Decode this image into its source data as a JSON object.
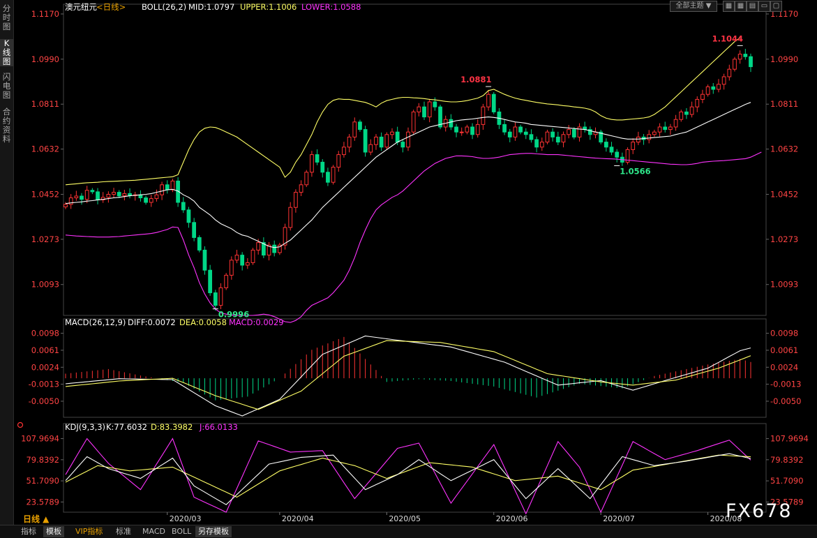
{
  "sidebar_tabs": [
    {
      "label": "分时图",
      "active": false
    },
    {
      "label": "K线图",
      "active": true
    },
    {
      "label": "闪电图",
      "active": false
    },
    {
      "label": "合约资料",
      "active": false
    }
  ],
  "top_controls": {
    "dropdown": "全部主题",
    "icons": [
      "grid-icon",
      "grid-alt-icon",
      "layout-icon",
      "restore-icon",
      "maximize-icon"
    ]
  },
  "bottom_tabs": [
    {
      "label": "指标",
      "active": false,
      "color": "#bbbbbb"
    },
    {
      "label": "模板",
      "active": true,
      "color": "#eeeeee"
    },
    {
      "label": "VIP指标",
      "active": false,
      "color": "#e8a000"
    },
    {
      "label": "标准",
      "active": false,
      "color": "#bbbbbb"
    },
    {
      "label": "MACD",
      "active": false,
      "color": "#bbbbbb"
    },
    {
      "label": "BOLL",
      "active": false,
      "color": "#bbbbbb"
    },
    {
      "label": "另存模板",
      "active": true,
      "color": "#eeeeee"
    }
  ],
  "watermark": "FX678",
  "period_label": "日线 ▲",
  "chart_data": [
    {
      "type": "candlestick",
      "panel": "price",
      "header": {
        "symbol": "澳元纽元",
        "period": "<日线>",
        "indicator": "BOLL(26,2)",
        "mid": "MID:1.0797",
        "upper": "UPPER:1.1006",
        "lower": "LOWER:1.0588"
      },
      "colors": {
        "up": "#ff3333",
        "down": "#00d787",
        "mid": "#ffffff",
        "upper": "#ffff66",
        "lower": "#ff33ff"
      },
      "yticks": [
        "1.1170",
        "1.0990",
        "1.0811",
        "1.0632",
        "1.0452",
        "1.0273",
        "1.0093"
      ],
      "ylim": [
        0.997,
        1.117
      ],
      "xticks": [
        "2020/03",
        "2020/04",
        "2020/05",
        "2020/06",
        "2020/07",
        "2020/08"
      ],
      "xtick_index": [
        19,
        40,
        60,
        80,
        100,
        120
      ],
      "annotations": [
        {
          "label": "1.1044",
          "index": 126,
          "value": 1.1044,
          "color": "#ff3344"
        },
        {
          "label": "1.0881",
          "index": 79,
          "value": 1.0881,
          "color": "#ff3344"
        },
        {
          "label": "0.9996",
          "index": 28,
          "value": 0.9996,
          "color": "#2ee88a"
        },
        {
          "label": "1.0566",
          "index": 103,
          "value": 1.0566,
          "color": "#2ee88a"
        }
      ],
      "close": [
        1.0412,
        1.0438,
        1.0445,
        1.0432,
        1.0468,
        1.0462,
        1.043,
        1.044,
        1.0452,
        1.046,
        1.0446,
        1.0455,
        1.0448,
        1.045,
        1.0438,
        1.042,
        1.0435,
        1.045,
        1.049,
        1.047,
        1.0505,
        1.042,
        1.039,
        1.034,
        1.028,
        1.023,
        1.015,
        1.006,
        1.001,
        1.008,
        1.013,
        1.019,
        1.021,
        1.017,
        1.018,
        1.023,
        1.026,
        1.021,
        1.025,
        1.022,
        1.025,
        1.032,
        1.04,
        1.046,
        1.049,
        1.054,
        1.061,
        1.058,
        1.054,
        1.05,
        1.056,
        1.061,
        1.064,
        1.068,
        1.074,
        1.071,
        1.062,
        1.065,
        1.068,
        1.064,
        1.069,
        1.07,
        1.066,
        1.064,
        1.07,
        1.078,
        1.08,
        1.076,
        1.082,
        1.08,
        1.072,
        1.075,
        1.072,
        1.07,
        1.07,
        1.072,
        1.069,
        1.073,
        1.08,
        1.085,
        1.078,
        1.073,
        1.07,
        1.068,
        1.072,
        1.07,
        1.069,
        1.067,
        1.064,
        1.066,
        1.07,
        1.068,
        1.066,
        1.069,
        1.071,
        1.068,
        1.072,
        1.071,
        1.069,
        1.07,
        1.066,
        1.064,
        1.062,
        1.06,
        1.058,
        1.063,
        1.066,
        1.068,
        1.067,
        1.069,
        1.07,
        1.072,
        1.071,
        1.072,
        1.075,
        1.078,
        1.077,
        1.08,
        1.083,
        1.085,
        1.088,
        1.087,
        1.089,
        1.092,
        1.095,
        1.099,
        1.101,
        1.1,
        1.096
      ],
      "boll_mid": [
        1.0415,
        1.0418,
        1.042,
        1.0422,
        1.0425,
        1.0427,
        1.043,
        1.0432,
        1.0435,
        1.0438,
        1.044,
        1.0443,
        1.0446,
        1.0448,
        1.045,
        1.0452,
        1.0455,
        1.046,
        1.0465,
        1.047,
        1.0472,
        1.0465,
        1.045,
        1.044,
        1.0425,
        1.04,
        1.0385,
        1.037,
        1.035,
        1.0335,
        1.0325,
        1.0315,
        1.03,
        1.029,
        1.0285,
        1.0275,
        1.0265,
        1.0255,
        1.0245,
        1.024,
        1.0243,
        1.0257,
        1.027,
        1.029,
        1.031,
        1.033,
        1.035,
        1.0375,
        1.04,
        1.042,
        1.044,
        1.046,
        1.048,
        1.05,
        1.052,
        1.054,
        1.056,
        1.058,
        1.06,
        1.0615,
        1.063,
        1.0645,
        1.066,
        1.067,
        1.068,
        1.069,
        1.07,
        1.071,
        1.072,
        1.0725,
        1.073,
        1.0735,
        1.074,
        1.0745,
        1.0748,
        1.075,
        1.0752,
        1.0755,
        1.0758,
        1.076,
        1.0758,
        1.0755,
        1.075,
        1.0745,
        1.074,
        1.0738,
        1.0735,
        1.073,
        1.0728,
        1.0726,
        1.0724,
        1.0722,
        1.072,
        1.0718,
        1.0716,
        1.0714,
        1.0712,
        1.071,
        1.0705,
        1.07,
        1.0695,
        1.069,
        1.0685,
        1.068,
        1.0675,
        1.0672,
        1.0672,
        1.0672,
        1.0674,
        1.0676,
        1.0678,
        1.068,
        1.0682,
        1.0684,
        1.069,
        1.0695,
        1.07,
        1.071,
        1.072,
        1.073,
        1.074,
        1.075,
        1.076,
        1.077,
        1.078,
        1.079,
        1.08,
        1.081,
        1.0818
      ],
      "boll_upper": [
        1.049,
        1.0492,
        1.0494,
        1.0496,
        1.0498,
        1.0499,
        1.05,
        1.0502,
        1.0503,
        1.0504,
        1.0505,
        1.0506,
        1.0507,
        1.0508,
        1.051,
        1.0512,
        1.0514,
        1.0516,
        1.0518,
        1.052,
        1.0522,
        1.053,
        1.058,
        1.063,
        1.067,
        1.07,
        1.0715,
        1.072,
        1.0718,
        1.071,
        1.07,
        1.069,
        1.068,
        1.0665,
        1.065,
        1.0635,
        1.062,
        1.0605,
        1.059,
        1.0575,
        1.056,
        1.052,
        1.054,
        1.058,
        1.061,
        1.065,
        1.069,
        1.074,
        1.078,
        1.081,
        1.0826,
        1.0832,
        1.083,
        1.083,
        1.0826,
        1.0822,
        1.0818,
        1.081,
        1.08,
        1.0815,
        1.0825,
        1.083,
        1.0835,
        1.0838,
        1.0838,
        1.0836,
        1.0835,
        1.0833,
        1.083,
        1.0828,
        1.0825,
        1.0822,
        1.082,
        1.082,
        1.0822,
        1.0825,
        1.083,
        1.0835,
        1.0845,
        1.0865,
        1.087,
        1.086,
        1.085,
        1.0842,
        1.0835,
        1.083,
        1.0826,
        1.0822,
        1.0818,
        1.0815,
        1.0812,
        1.081,
        1.0808,
        1.0805,
        1.0803,
        1.08,
        1.0798,
        1.0795,
        1.079,
        1.078,
        1.0765,
        1.0755,
        1.075,
        1.0748,
        1.0748,
        1.075,
        1.0752,
        1.0754,
        1.0756,
        1.076,
        1.077,
        1.0785,
        1.08,
        1.082,
        1.084,
        1.086,
        1.088,
        1.09,
        1.092,
        1.094,
        1.096,
        1.098,
        1.1,
        1.102,
        1.104,
        1.106,
        1.1075
      ],
      "boll_lower": [
        1.029,
        1.0288,
        1.0286,
        1.0285,
        1.0284,
        1.0283,
        1.0282,
        1.0282,
        1.0282,
        1.0283,
        1.0284,
        1.0286,
        1.0288,
        1.029,
        1.0292,
        1.0294,
        1.0296,
        1.03,
        1.0306,
        1.0312,
        1.0322,
        1.032,
        1.027,
        1.021,
        1.016,
        1.01,
        1.0055,
        1.002,
        0.9995,
        0.998,
        0.9975,
        0.9972,
        0.997,
        0.997,
        0.997,
        0.997,
        0.9972,
        0.9975,
        0.9972,
        0.9965,
        0.9955,
        0.9945,
        0.9942,
        0.995,
        0.9965,
        0.999,
        1.001,
        1.002,
        1.003,
        1.004,
        1.006,
        1.0085,
        1.011,
        1.015,
        1.02,
        1.026,
        1.031,
        1.0355,
        1.039,
        1.041,
        1.0425,
        1.044,
        1.045,
        1.0465,
        1.0485,
        1.0505,
        1.0525,
        1.0545,
        1.056,
        1.0575,
        1.0585,
        1.0595,
        1.06,
        1.0605,
        1.0605,
        1.0604,
        1.0602,
        1.0598,
        1.0595,
        1.0595,
        1.0597,
        1.06,
        1.0605,
        1.061,
        1.0612,
        1.0614,
        1.0615,
        1.0615,
        1.0613,
        1.0612,
        1.061,
        1.061,
        1.061,
        1.0608,
        1.0606,
        1.0604,
        1.0602,
        1.06,
        1.0598,
        1.0596,
        1.0595,
        1.0594,
        1.0593,
        1.0592,
        1.059,
        1.0588,
        1.0586,
        1.0584,
        1.0582,
        1.058,
        1.0578,
        1.0576,
        1.0574,
        1.0572,
        1.0571,
        1.057,
        1.057,
        1.0572,
        1.0575,
        1.058,
        1.0582,
        1.0584,
        1.0585,
        1.0586,
        1.0588,
        1.059,
        1.0592,
        1.0594,
        1.06,
        1.061,
        1.062
      ]
    },
    {
      "type": "macd",
      "panel": "macd",
      "header": {
        "name": "MACD(26,12,9)",
        "diff": "DIFF:0.0072",
        "dea": "DEA:0.0058",
        "macd": "MACD:0.0029"
      },
      "colors": {
        "diff": "#ffffff",
        "dea": "#ffff66",
        "up": "#ff3333",
        "down": "#00d787"
      },
      "yticks": [
        "0.0098",
        "0.0061",
        "0.0024",
        "-0.0013",
        "-0.0050"
      ],
      "ylim": [
        -0.0085,
        0.0108
      ],
      "diff_keys": [
        [
          0,
          -0.0012
        ],
        [
          10,
          -0.0001
        ],
        [
          20,
          -0.0003
        ],
        [
          28,
          -0.006
        ],
        [
          33,
          -0.0082
        ],
        [
          40,
          -0.0046
        ],
        [
          48,
          0.0052
        ],
        [
          56,
          0.0092
        ],
        [
          64,
          0.008
        ],
        [
          72,
          0.0068
        ],
        [
          82,
          0.0035
        ],
        [
          92,
          -0.0015
        ],
        [
          100,
          -0.0005
        ],
        [
          106,
          -0.0026
        ],
        [
          112,
          -0.0005
        ],
        [
          120,
          0.0022
        ],
        [
          126,
          0.006
        ],
        [
          130,
          0.0072
        ]
      ],
      "dea_keys": [
        [
          0,
          -0.0018
        ],
        [
          10,
          -0.0006
        ],
        [
          20,
          0.0
        ],
        [
          28,
          -0.0038
        ],
        [
          36,
          -0.0068
        ],
        [
          44,
          -0.0028
        ],
        [
          52,
          0.0048
        ],
        [
          60,
          0.0082
        ],
        [
          70,
          0.0078
        ],
        [
          80,
          0.0058
        ],
        [
          90,
          0.001
        ],
        [
          100,
          -0.0008
        ],
        [
          106,
          -0.0015
        ],
        [
          114,
          -0.0004
        ],
        [
          122,
          0.0022
        ],
        [
          130,
          0.0058
        ]
      ],
      "hist_keys": [
        [
          0,
          0.001
        ],
        [
          8,
          0.002
        ],
        [
          14,
          0.0006
        ],
        [
          22,
          -0.001
        ],
        [
          28,
          -0.0048
        ],
        [
          34,
          -0.004
        ],
        [
          40,
          0.0
        ],
        [
          46,
          0.0062
        ],
        [
          52,
          0.009
        ],
        [
          58,
          0.0018
        ],
        [
          60,
          -0.0008
        ],
        [
          66,
          -0.0002
        ],
        [
          72,
          -0.0006
        ],
        [
          80,
          -0.0018
        ],
        [
          88,
          -0.0042
        ],
        [
          96,
          -0.0012
        ],
        [
          104,
          -0.0022
        ],
        [
          110,
          0.0005
        ],
        [
          120,
          0.003
        ],
        [
          126,
          0.0042
        ],
        [
          130,
          0.0029
        ]
      ]
    },
    {
      "type": "kdj",
      "panel": "kdj",
      "header": {
        "name": "KDJ(9,3,3)",
        "k": "K:77.6032",
        "d": "D:83.3982",
        "j": "J:66.0133"
      },
      "colors": {
        "k": "#ffffff",
        "d": "#ffff66",
        "j": "#ff33ff"
      },
      "yticks": [
        "107.9694",
        "79.8392",
        "51.7090",
        "23.5789"
      ],
      "ylim": [
        10,
        115
      ],
      "k_keys": [
        [
          0,
          52
        ],
        [
          4,
          84
        ],
        [
          8,
          68
        ],
        [
          14,
          55
        ],
        [
          20,
          82
        ],
        [
          24,
          45
        ],
        [
          30,
          20
        ],
        [
          38,
          74
        ],
        [
          44,
          83
        ],
        [
          50,
          86
        ],
        [
          56,
          40
        ],
        [
          62,
          60
        ],
        [
          66,
          80
        ],
        [
          72,
          52
        ],
        [
          80,
          80
        ],
        [
          86,
          28
        ],
        [
          92,
          68
        ],
        [
          98,
          28
        ],
        [
          104,
          84
        ],
        [
          110,
          72
        ],
        [
          116,
          78
        ],
        [
          124,
          88
        ],
        [
          130,
          78
        ]
      ],
      "d_keys": [
        [
          0,
          50
        ],
        [
          6,
          72
        ],
        [
          12,
          65
        ],
        [
          20,
          70
        ],
        [
          26,
          50
        ],
        [
          32,
          30
        ],
        [
          40,
          65
        ],
        [
          48,
          82
        ],
        [
          54,
          72
        ],
        [
          60,
          55
        ],
        [
          68,
          76
        ],
        [
          76,
          70
        ],
        [
          84,
          52
        ],
        [
          92,
          58
        ],
        [
          100,
          40
        ],
        [
          106,
          66
        ],
        [
          114,
          76
        ],
        [
          122,
          86
        ],
        [
          130,
          83
        ]
      ],
      "j_keys": [
        [
          0,
          60
        ],
        [
          4,
          108
        ],
        [
          8,
          75
        ],
        [
          14,
          40
        ],
        [
          20,
          108
        ],
        [
          24,
          30
        ],
        [
          30,
          10
        ],
        [
          36,
          105
        ],
        [
          42,
          90
        ],
        [
          48,
          92
        ],
        [
          54,
          28
        ],
        [
          62,
          95
        ],
        [
          66,
          102
        ],
        [
          72,
          22
        ],
        [
          80,
          100
        ],
        [
          86,
          8
        ],
        [
          92,
          104
        ],
        [
          96,
          70
        ],
        [
          100,
          10
        ],
        [
          106,
          104
        ],
        [
          112,
          80
        ],
        [
          118,
          92
        ],
        [
          124,
          106
        ],
        [
          130,
          66
        ]
      ]
    }
  ]
}
